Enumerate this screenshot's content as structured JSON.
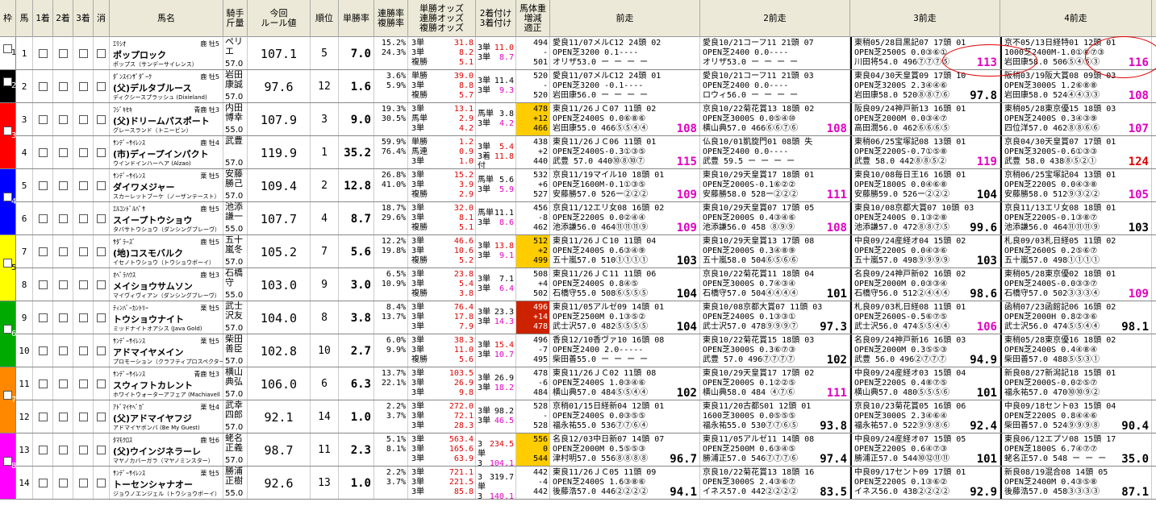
{
  "header": {
    "waku": "枠",
    "uma": "馬",
    "chk1": "1着",
    "chk2": "2着",
    "chk3": "3着",
    "scratch": "消",
    "name": "馬名",
    "jockey": "騎手\n斤量",
    "rule": "今回\nルール値",
    "rank": "順位",
    "win_rate": "単勝率",
    "ren_rate": "連勝率\n複勝率",
    "odds": "単勝オッズ\n連勝オッズ\n複勝オッズ",
    "odds2": "2着付け\n3着付け",
    "body_weight": "馬体重\n増減\n適正",
    "p1": "前走",
    "p2": "2前走",
    "p3": "3前走",
    "p4": "4前走"
  },
  "colors": {
    "waku": [
      "#ffffff",
      "#000000",
      "#ff0000",
      "#0000ff",
      "#ffff00",
      "#00aa00",
      "#ff8800",
      "#ff00ff"
    ],
    "wh_hl": "#ffcc00",
    "wh_hl_red": "#cc2200"
  },
  "rows": [
    {
      "num": "1",
      "waku": 1,
      "sire": "ｴﾘｼｵ",
      "sx": "鹿 牡5",
      "name": "ポップロック",
      "dam": "ポップス（サンデーサイレンス）",
      "jockey": [
        "ペリ",
        "エ"
      ],
      "weight": "57.0",
      "rule": "107.1",
      "rank": "5",
      "tan": "7.0",
      "ren": [
        "15.2%",
        "24.3%"
      ],
      "odds": [
        [
          "3単",
          "31.8"
        ],
        [
          "3単",
          "8.2"
        ],
        [
          "複勝",
          "5.1"
        ]
      ],
      "odds2": [
        [
          "3単",
          "11.0"
        ],
        [
          "3単",
          "8.7"
        ]
      ],
      "bw": [
        "494",
        "-",
        "501"
      ],
      "bwhl": "",
      "p1": [
        "愛良11/07メルC12 24頭 02",
        "OPEN芝3200  0.1----",
        "オリザ53.0  ー ー ー ー"
      ],
      "p1s": "",
      "p2": [
        "愛良10/21コーフ11 21頭 07",
        "OPEN芝2400  0.0----",
        "オリザ53.0  ー ー ー ー"
      ],
      "p2s": "",
      "p3": [
        "東稍05/28目黒記07 17頭 01",
        "OPEN芝2500S 0.0③⑥①",
        "川田将54.0 496⑦⑦⑦⑤"
      ],
      "p3s": "113",
      "p4": [
        "京不05/13日経特01 12頭 01",
        "1000芝2400M-1.0①⑧⑦③",
        "岩田康58.0 506⑤④⑤③"
      ],
      "p4s": "116"
    },
    {
      "num": "2",
      "waku": 2,
      "sire": "ﾀﾞﾝｽｲﾝｻﾞﾀﾞｰｸ",
      "sx": "鹿 牡5",
      "name": "(父)デルタブルース",
      "dam": "ディクシースプラッシュ (Dixieland)",
      "jockey": [
        "岩田",
        "康誠"
      ],
      "weight": "57.0",
      "rule": "97.6",
      "rank": "12",
      "tan": "1.6",
      "ren": [
        "3.6%",
        "5.9%"
      ],
      "odds": [
        [
          "単勝",
          "39.0"
        ],
        [
          "3単",
          "8.8"
        ],
        [
          "複勝",
          "5.7"
        ]
      ],
      "odds2": [
        [
          "3単",
          "11.4"
        ],
        [
          "3単",
          "9.3"
        ]
      ],
      "bw": [
        "520",
        "-",
        "520"
      ],
      "bwhl": "",
      "p1": [
        "愛良11/07メルC12 24頭 01",
        "OPEN芝3200 -0.1----",
        "岩田康56.0  ー ー ー ー"
      ],
      "p1s": "",
      "p2": [
        "愛良10/21コーフ11 21頭 03",
        "OPEN芝2400  0.0----",
        "ロウィ56.0  ー ー ー ー"
      ],
      "p2s": "",
      "p3": [
        "東良04/30天皇賞09 17頭 10",
        "OPEN芝3200S 2.3④④⑥",
        "岩田康58.0 520⑧⑧⑦⑥"
      ],
      "p3s": "97.8",
      "p4": [
        "阪稍03/19阪大賞08 09頭 03",
        "OPEN芝3000S 1.2⑥⑧⑧",
        "岩田康58.0 524④④③③"
      ],
      "p4s": "108"
    },
    {
      "num": "3",
      "waku": 3,
      "sire": "ﾌｼﾞｷｾｷ",
      "sx": "青鹿 牡3",
      "name": "(父)ドリームパスポート",
      "dam": "グレースランド（トニービン）",
      "jockey": [
        "内田",
        "博幸"
      ],
      "weight": "55.0",
      "rule": "107.9",
      "rank": "3",
      "tan": "9.0",
      "ren": [
        "19.3%",
        "30.5%"
      ],
      "odds": [
        [
          "3単",
          "13.1"
        ],
        [
          "馬単",
          "2.9"
        ],
        [
          "3単",
          "4.2"
        ]
      ],
      "odds2": [
        [
          "馬単",
          "3.8"
        ],
        [
          "3単",
          "4.2"
        ]
      ],
      "bw": [
        "478",
        "+12",
        "466"
      ],
      "bwhl": "y",
      "p1": [
        "東良11/26ＪＣ07 11頭 02",
        "OPEN芝2400S 0.0⑥⑧⑥",
        "岩田康55.0 466⑤⑤④④"
      ],
      "p1s": "108",
      "p2": [
        "京良10/22菊花賞13 18頭 02",
        "OPEN芝3000S 0.0⑤④⑩",
        "横山典57.0 466⑥⑥⑦⑥"
      ],
      "p2s": "108",
      "p3": [
        "阪良09/24神戸新13 16頭 01",
        "OPEN芝2000M 0.0③④⑦",
        "高田潤56.0 462⑥⑥⑥⑤"
      ],
      "p3s": "",
      "p4": [
        "東稍05/28東京優15 18頭 03",
        "OPEN芝2400S 0.3④③⑨",
        "四位洋57.0 462⑧⑧⑥⑥"
      ],
      "p4s": "107"
    },
    {
      "num": "4",
      "waku": 3,
      "sire": "ｻﾝﾃﾞｰｻｲﾚﾝｽ",
      "sx": "鹿 牡4",
      "name": "(市)ディープインパクト",
      "dam": "ウインドインハーヘア (Alzao)",
      "jockey": [
        "武豊",
        ""
      ],
      "weight": "57.0",
      "rule": "119.9",
      "rank": "1",
      "tan": "35.2",
      "ren": [
        "59.9%",
        "76.4%"
      ],
      "odds": [
        [
          "単勝",
          "1.2"
        ],
        [
          "馬連",
          "0.9"
        ],
        [
          "3単",
          "1.0"
        ]
      ],
      "odds2": [
        [
          "3単",
          "5.4"
        ],
        [
          "3着付",
          "11.8"
        ]
      ],
      "bw": [
        "438",
        "+2",
        "440"
      ],
      "bwhl": "",
      "p1": [
        "東良11/26ＪＣ06 11頭 01",
        "OPEN芝2400S-0.3①③⑤",
        "武豊 57.0 440⑩⑧⑩⑦"
      ],
      "p1s": "115",
      "p2": [
        "仏良10/01凱旋門01 08頭 失",
        "OPEN芝2400 0.0----",
        "武豊  59.5 ー ー ー ー"
      ],
      "p2s": "",
      "p3": [
        "東稍06/25宝塚記08 13頭 01",
        "OPEN芝2200S-0.7①⑤⑧",
        "武豊 58.0 442⑧⑧⑤②"
      ],
      "p3s": "119",
      "p4": [
        "京良04/30天皇賞07 17頭 01",
        "OPEN芝3200S-0.6①③③",
        "武豊 58.0 438⑧⑤②①"
      ],
      "p4s": "124"
    },
    {
      "num": "5",
      "waku": 4,
      "sire": "ｻﾝﾃﾞｰｻｲﾚﾝｽ",
      "sx": "栗 牡5",
      "name": "ダイワメジャー",
      "dam": "スカーレットブーケ（ノーザンテースト）",
      "jockey": [
        "安藤",
        "勝己"
      ],
      "weight": "57.0",
      "rule": "109.4",
      "rank": "2",
      "tan": "12.8",
      "ren": [
        "26.8%",
        "41.0%"
      ],
      "odds": [
        [
          "3単",
          "15.2"
        ],
        [
          "3単",
          "3.9"
        ],
        [
          "複勝",
          "2.9"
        ]
      ],
      "odds2": [
        [
          "馬単",
          "5.6"
        ],
        [
          "3単",
          "5.9"
        ]
      ],
      "bw": [
        "532",
        "+6",
        "527"
      ],
      "bwhl": "",
      "p1": [
        "京良11/19マイル10 18頭 01",
        "OPEN芝1600M-0.1①③⑤",
        "安藤勝57.0 526ー②②②"
      ],
      "p1s": "109",
      "p2": [
        "東良10/29天皇賞17 18頭 01",
        "OPEN芝2000S-0.1⑥②②",
        "安藤勝58.0 528ー②②②"
      ],
      "p2s": "111",
      "p3": [
        "東良10/08毎日王16 16頭 01",
        "OPEN芝1800S 0.0④⑥⑧",
        "安藤勝59.0 526ー②②②"
      ],
      "p3s": "104",
      "p4": [
        "京稍06/25宝塚記04 13頭 01",
        "OPEN芝2200S 0.0④③⑧",
        "安藤勝58.0 512⑨③②②"
      ],
      "p4s": "105"
    },
    {
      "num": "6",
      "waku": 4,
      "sire": "ｴﾙｺﾝﾄﾞﾙﾊﾟｻ",
      "sx": "鹿 牡5",
      "name": "スイープトウショウ",
      "dam": "タバサトウショウ（ダンシングブレーヴ）",
      "jockey": [
        "池添",
        "謙一"
      ],
      "weight": "55.0",
      "rule": "107.7",
      "rank": "4",
      "tan": "8.7",
      "ren": [
        "18.7%",
        "29.6%"
      ],
      "odds": [
        [
          "3単",
          "32.0"
        ],
        [
          "3単",
          "8.1"
        ],
        [
          "複勝",
          "5.1"
        ]
      ],
      "odds2": [
        [
          "馬単",
          "11.1"
        ],
        [
          "3単",
          "8.6"
        ]
      ],
      "bw": [
        "456",
        "-8",
        "462"
      ],
      "bwhl": "",
      "p1": [
        "京良11/12エリ女08 16頭 02",
        "OPEN芝2200S 0.0②④④",
        "池添謙56.0 464⑪⑪⑪⑨"
      ],
      "p1s": "109",
      "p2": [
        "東良10/29天皇賞07 17頭 05",
        "OPEN芝2000S 0.4③④⑥",
        "池添謙56.0 458 ⑧⑨⑨"
      ],
      "p2s": "108",
      "p3": [
        "東良10/08京都大賞07 10頭 03",
        "OPEN芝2400S 0.1③②⑧",
        "池添謙57.0 472⑧⑧⑦⑤"
      ],
      "p3s": "99.6",
      "p4": [
        "京良11/13エリ女08 18頭 01",
        "OPEN芝2200S-0.1③⑧⑦",
        "池添謙56.0 464⑪⑪⑪⑨"
      ],
      "p4s": "103"
    },
    {
      "num": "7",
      "waku": 5,
      "sire": "ｻﾀﾞﾗｰｽﾞ",
      "sx": "鹿 牡5",
      "name": "(地)コスモバルク",
      "dam": "イセノトウショウ（トウショウボーイ）",
      "jockey": [
        "五十",
        "嵐冬"
      ],
      "weight": "57.0",
      "rule": "105.2",
      "rank": "7",
      "tan": "5.6",
      "ren": [
        "12.2%",
        "19.8%"
      ],
      "odds": [
        [
          "3単",
          "46.6"
        ],
        [
          "3単",
          "10.6"
        ],
        [
          "複勝",
          "5.2"
        ]
      ],
      "odds2": [
        [
          "3単",
          "13.8"
        ],
        [
          "3単",
          "9.1"
        ]
      ],
      "bw": [
        "512",
        "+2",
        "499"
      ],
      "bwhl": "y",
      "p1": [
        "東良11/26ＪＣ10 11頭 04",
        "OPEN芝2400S 0.6③④⑨",
        "五十嵐57.0 510①①①①"
      ],
      "p1s": "103",
      "p2": [
        "東良10/29天皇賞13 17頭 08",
        "OPEN芝2000S 0.3④⑧⑨",
        "五十嵐58.0 504⑥⑤⑥⑥"
      ],
      "p2s": "",
      "p3": [
        "中良09/24産経オ04 15頭 02",
        "OPEN芝2200S 0.0④③⑥",
        "五十嵐57.0 498⑨⑨⑨⑨"
      ],
      "p3s": "103",
      "p4": [
        "札良09/03札日経05 11頭 02",
        "OPEN芝2600S 0.2⑤⑥⑦",
        "五十嵐57.0 498①①①①"
      ],
      "p4s": ""
    },
    {
      "num": "8",
      "waku": 5,
      "sire": "ｵﾍﾟﾗﾊｳｽ",
      "sx": "鹿 牡3",
      "name": "メイショウサムソン",
      "dam": "マイヴィヴィアン（ダンシングブレーヴ）",
      "jockey": [
        "石橋",
        "守"
      ],
      "weight": "55.0",
      "rule": "103.0",
      "rank": "9",
      "tan": "3.0",
      "ren": [
        "6.5%",
        "10.9%"
      ],
      "odds": [
        [
          "3単",
          "23.8"
        ],
        [
          "3単",
          "5.4"
        ],
        [
          "複勝",
          "3.8"
        ]
      ],
      "odds2": [
        [
          "3単",
          "7.1"
        ],
        [
          "3単",
          "6.4"
        ]
      ],
      "bw": [
        "508",
        "+4",
        "502"
      ],
      "bwhl": "",
      "p1": [
        "東良11/26ＪＣ11 11頭 06",
        "OPEN芝2400S 0.8④⑤",
        "石橋守55.0 508⑥⑤⑤⑤"
      ],
      "p1s": "104",
      "p2": [
        "京良10/22菊花賞11 18頭 04",
        "OPEN芝3000S 0.7④③④",
        "石橋守57.0 504④④④④"
      ],
      "p2s": "101",
      "p3": [
        "名良09/24神戸新02 16頭 02",
        "OPEN芝2000M 0.0③③④",
        "石橋守56.0 512②④④④"
      ],
      "p3s": "98.6",
      "p4": [
        "東稍05/28東京優02 18頭 01",
        "OPEN芝2400S-0.0③③⑦",
        "石橋守57.0 502③③③④"
      ],
      "p4s": "109"
    },
    {
      "num": "9",
      "waku": 6,
      "sire": "ﾃｨﾝﾊﾞｰｶﾝﾄﾘｰ",
      "sx": "栗 牡5",
      "name": "トウショウナイト",
      "dam": "ミッドナイトオアシス (Java Gold)",
      "jockey": [
        "武士",
        "沢友"
      ],
      "weight": "57.0",
      "rule": "104.0",
      "rank": "8",
      "tan": "3.8",
      "ren": [
        "8.4%",
        "13.7%"
      ],
      "odds": [
        [
          "3単",
          "76.4"
        ],
        [
          "3単",
          "17.8"
        ],
        [
          "3単",
          "7.9"
        ]
      ],
      "odds2": [
        [
          "3単",
          "23.3"
        ],
        [
          "3単",
          "14.3"
        ]
      ],
      "bw": [
        "496",
        "+14",
        "478"
      ],
      "bwhl": "r",
      "p1": [
        "東良11/05アルゼ09 14頭 01",
        "OPEN芝2500M 0.1③⑤②",
        "武士沢57.0 482⑤⑤⑤⑤"
      ],
      "p1s": "104",
      "p2": [
        "東良10/08京都大賞07 11頭 03",
        "OPEN芝2400S 0.1③③①",
        "武士沢57.0 478⑨⑨⑨⑦"
      ],
      "p2s": "97.3",
      "p3": [
        "札良09/03札日経08 11頭 01",
        "OPEN芝2600S-0.5⑥⑦⑤",
        "武士沢56.0 474⑤⑤④④"
      ],
      "p3s": "106",
      "p4": [
        "函稍07/23函館記06 16頭 02",
        "OPEN芝2000H 0.8②③⑥",
        "武士沢56.0 474⑤⑤④④"
      ],
      "p4s": "98.1"
    },
    {
      "num": "10",
      "waku": 6,
      "sire": "ｻﾝﾃﾞｰｻｲﾚﾝｽ",
      "sx": "栗 牡5",
      "name": "アドマイヤメイン",
      "dam": "プロモーション（クラフティプロスペクター）",
      "jockey": [
        "柴田",
        "善臣"
      ],
      "weight": "57.0",
      "rule": "102.8",
      "rank": "10",
      "tan": "2.7",
      "ren": [
        "6.0%",
        "9.9%"
      ],
      "odds": [
        [
          "3単",
          "38.3"
        ],
        [
          "3単",
          "11.0"
        ],
        [
          "複勝",
          "5.6"
        ]
      ],
      "odds2": [
        [
          "3単",
          "15.4"
        ],
        [
          "3単",
          "10.7"
        ]
      ],
      "bw": [
        "496",
        "-7",
        "495"
      ],
      "bwhl": "",
      "p1": [
        "香良12/10香ヴァ10 16頭 08",
        "OPEN芝2400  2.0-----",
        "柴田善55.0  ー ー ー ー"
      ],
      "p1s": "",
      "p2": [
        "東良10/22菊花賞15 18頭 03",
        "OPEN芝3000S 0.3⑥⑦③",
        "武豊 57.0 496⑦⑦⑦⑦"
      ],
      "p2s": "102",
      "p3": [
        "名良09/24神戸新16 16頭 03",
        "OPEN芝2000M 0.3⑤⑤③",
        "武豊 56.0 496②⑦⑦⑦"
      ],
      "p3s": "94.9",
      "p4": [
        "東稍05/28東京優16 18頭 02",
        "OPEN芝2400S 0.4④⑧④",
        "柴田善57.0 488⑤⑤③①"
      ],
      "p4s": ""
    },
    {
      "num": "11",
      "waku": 7,
      "sire": "ｻﾝﾃﾞｰｻｲﾚﾝｽ",
      "sx": "青鹿 牡3",
      "name": "スウィフトカレント",
      "dam": "ホワイトウォーターアフェア (Machiavell",
      "jockey": [
        "横山",
        "典弘"
      ],
      "weight": "57.0",
      "rule": "106.0",
      "rank": "6",
      "tan": "6.3",
      "ren": [
        "13.7%",
        "22.1%"
      ],
      "odds": [
        [
          "3単",
          "103.5"
        ],
        [
          "3単",
          "26.9"
        ],
        [
          "3単",
          "9.8"
        ]
      ],
      "odds2": [
        [
          "3単",
          "26.9"
        ],
        [
          "3単",
          "18.2"
        ]
      ],
      "bw": [
        "478",
        "-6",
        "484"
      ],
      "bwhl": "",
      "p1": [
        "東良11/26ＪＣ02 11頭 08",
        "OPEN芝2400S 1.0③④⑥",
        "横山典57.0 484⑤⑤④④"
      ],
      "p1s": "102",
      "p2": [
        "東良10/29天皇賞17 17頭 02",
        "OPEN芝2000S 0.1②②⑤",
        "横山典58.0 484 ④⑦⑥"
      ],
      "p2s": "111",
      "p3": [
        "中良09/24産経オ03 15頭 04",
        "OPEN芝2200S 0.4⑧⑦⑤",
        "横山典57.0 480⑤⑤⑤⑥"
      ],
      "p3s": "101",
      "p4": [
        "新良08/27新潟記18 15頭 01",
        "OPEN芝2000S-0.0②⑤⑦",
        "福永祐57.0 470⑩⑩⑨②"
      ],
      "p4s": ""
    },
    {
      "num": "12",
      "waku": 7,
      "sire": "ｱﾄﾞﾏｲﾔﾍﾞｶﾞ",
      "sx": "栗 牡4",
      "name": "(父)アドマイヤフジ",
      "dam": "アドマイヤボンバ (Be My Guest)",
      "jockey": [
        "武幸",
        "四郎"
      ],
      "weight": "57.0",
      "rule": "92.1",
      "rank": "14",
      "tan": "1.0",
      "ren": [
        "2.2%",
        "3.7%"
      ],
      "odds": [
        [
          "3単",
          "272.0"
        ],
        [
          "3単",
          "72.1"
        ],
        [
          "3単",
          "28.3"
        ]
      ],
      "odds2": [
        [
          "3単",
          "98.2"
        ],
        [
          "3単",
          "46.5"
        ]
      ],
      "bw": [
        "528",
        "-",
        "528"
      ],
      "bwhl": "",
      "p1": [
        "京稍01/15日経新04 12頭 01",
        "OPEN芝2400S 0.0③⑤⑤",
        "福永祐55.0 536⑦⑦⑥④"
      ],
      "p1s": "",
      "p2": [
        "東良11/20古都S01 12頭 01",
        "1600芝3000S 0.0⑤⑤⑤",
        "福永祐55.0 530⑦⑦⑥⑤"
      ],
      "p2s": "93.8",
      "p3": [
        "京良10/23菊花賞05 16頭 06",
        "OPEN芝3000S 2.3④⑥④",
        "福永祐57.0 522⑨⑨⑧⑥"
      ],
      "p3s": "92.4",
      "p4": [
        "中良09/18セント03 15頭 04",
        "OPEN芝2200S 0.8④④⑥",
        "柴田善57.0 524⑨⑨⑨⑧"
      ],
      "p4s": "90.4"
    },
    {
      "num": "13",
      "waku": 8,
      "sire": "ﾀﾏﾓｸﾛｽ",
      "sx": "鹿 牡6",
      "name": "(父)ウインジネラーレ",
      "dam": "マヤノカバーガラ（マヤノミンスター）",
      "jockey": [
        "蛯名",
        "正義"
      ],
      "weight": "57.0",
      "rule": "98.7",
      "rank": "11",
      "tan": "2.3",
      "ren": [
        "5.1%",
        "8.1%"
      ],
      "odds": [
        [
          "3単",
          "563.4"
        ],
        [
          "3単",
          "165.6"
        ],
        [
          "3単",
          "63.9"
        ]
      ],
      "odds2": [
        [
          "3単",
          "234.5"
        ],
        [
          "3単",
          "104.1"
        ]
      ],
      "bw": [
        "556",
        "0",
        "544"
      ],
      "bwhl": "y",
      "p1": [
        "名良12/03中日新07 14頭 07",
        "OPEN芝2000M 0.5⑤⑤③",
        "津村明57.0 556⑧⑧⑧⑧"
      ],
      "p1s": "96.7",
      "p2": [
        "東良11/05アルゼ11 14頭 08",
        "OPEN芝2500M 0.6③④⑤",
        "勝浦正57.0 546⑦⑦⑦⑥"
      ],
      "p2s": "97.4",
      "p3": [
        "中良09/24産経オ07 15頭 05",
        "OPEN芝2200S 0.6④⑦③",
        "勝浦正57.0 544⑩⑫⑪⑪"
      ],
      "p3s": "101",
      "p4": [
        "東良06/12エプソ08 15頭 17",
        "OPEN芝1800S 6.7④⑦⑦",
        "蛯名正57.0 548 ー ー ー"
      ],
      "p4s": "35.0"
    },
    {
      "num": "14",
      "waku": 8,
      "sire": "ｻﾝﾃﾞｰｻｲﾚﾝｽ",
      "sx": "栗 牡5",
      "name": "トーセンシャナオー",
      "dam": "ジョウノエンジェル（トウショウボーイ）",
      "jockey": [
        "勝浦",
        "正樹"
      ],
      "weight": "55.0",
      "rule": "92.6",
      "rank": "13",
      "tan": "1.0",
      "ren": [
        "2.2%",
        "3.7%"
      ],
      "odds": [
        [
          "3単",
          "721.1"
        ],
        [
          "3単",
          "221.5"
        ],
        [
          "3単",
          "85.8"
        ]
      ],
      "odds2": [
        [
          "3単",
          "319.7"
        ],
        [
          "3単",
          "140.1"
        ]
      ],
      "bw": [
        "442",
        "-4",
        "442"
      ],
      "bwhl": "",
      "p1": [
        "東良11/26ＪＣ05 11頭 09",
        "OPEN芝2400S 1.6③⑧⑥",
        "後藤浩57.0 446②②②②"
      ],
      "p1s": "94.1",
      "p2": [
        "京良10/22菊花賞13 18頭 16",
        "OPEN芝3000S 2.4③⑥⑦",
        "イネス57.0 442②②②②"
      ],
      "p2s": "83.5",
      "p3": [
        "中良09/17セント09 17頭 01",
        "OPEN芝2200S 0.1③⑥②",
        "イネス56.0 438②②②②"
      ],
      "p3s": "92.9",
      "p4": [
        "新良08/19混合08 14頭 05",
        "OPEN芝2400M 0.4③⑤⑧",
        "後藤浩57.0 458③③③③"
      ],
      "p4s": "87.1"
    }
  ]
}
